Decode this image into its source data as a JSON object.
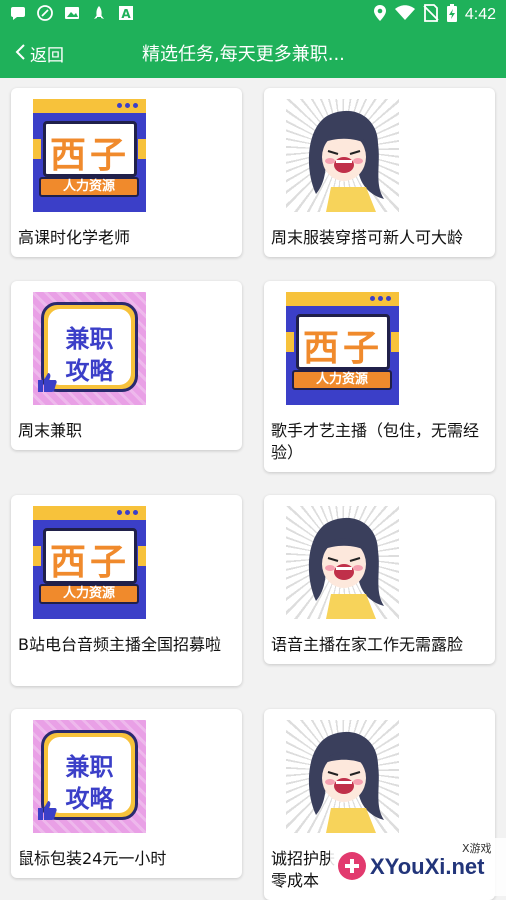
{
  "status_bar": {
    "time": "4:42",
    "left_icons": [
      "message-icon",
      "compass-icon",
      "image-icon",
      "rocket-icon",
      "font-icon"
    ],
    "right_icons": [
      "location-icon",
      "wifi-icon",
      "no-sim-icon",
      "battery-icon"
    ]
  },
  "nav": {
    "back_label": "返回",
    "title": "精选任务,每天更多兼职..."
  },
  "thumb_text": {
    "xizi_big": "西子",
    "xizi_ribbon": "人力资源",
    "jianzhi_line1": "兼职",
    "jianzhi_line2": "攻略"
  },
  "jobs": [
    {
      "title": "高课时化学老师",
      "image": "xizi"
    },
    {
      "title": "周末服装穿搭可新人可大龄",
      "image": "comic"
    },
    {
      "title": "周末兼职",
      "image": "jianzhi"
    },
    {
      "title": "歌手才艺主播（包住，无需经验）",
      "image": "xizi"
    },
    {
      "title": "B站电台音频主播全国招募啦",
      "image": "xizi"
    },
    {
      "title": "语音主播在家工作无需露脸",
      "image": "comic"
    },
    {
      "title": "鼠标包装24元一小时",
      "image": "jianzhi"
    },
    {
      "title": "诚招护肤零成本",
      "image": "comic"
    }
  ],
  "watermark": {
    "text": "XYouXi.net",
    "small": "X游戏"
  },
  "colors": {
    "brand_green": "#1fb15a",
    "xizi_blue": "#3b3fc8",
    "accent_orange": "#f08a2c",
    "accent_yellow": "#f7c23b"
  }
}
